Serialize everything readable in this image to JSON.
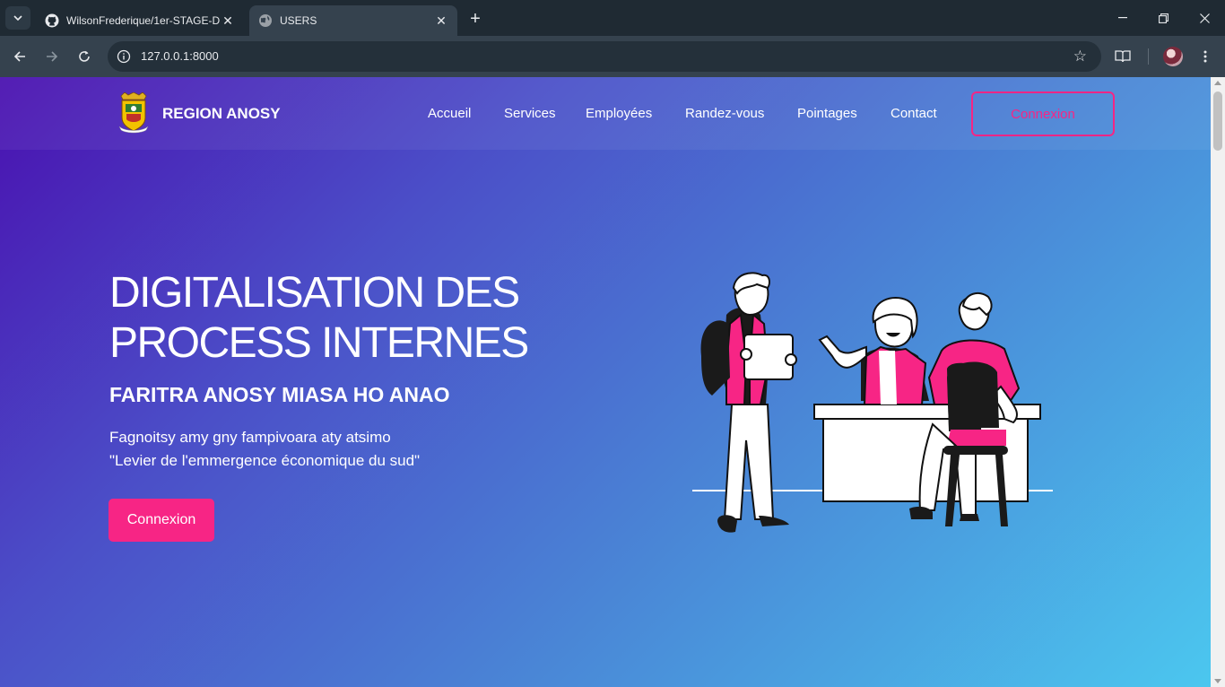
{
  "browser": {
    "tabs": [
      {
        "title": "WilsonFrederique/1er-STAGE-D",
        "icon": "github-icon"
      },
      {
        "title": "USERS",
        "icon": "globe-icon"
      }
    ],
    "url": "127.0.0.1:8000"
  },
  "header": {
    "brand": "REGION ANOSY",
    "nav": [
      "Accueil",
      "Services",
      "Employées",
      "Randez-vous",
      "Pointages",
      "Contact"
    ],
    "login_button": "Connexion"
  },
  "hero": {
    "title_line1": "DIGITALISATION DES",
    "title_line2": "PROCESS INTERNES",
    "subtitle": "FARITRA ANOSY MIASA HO ANAO",
    "para_line1": "Fagnoitsy amy gny fampivoara aty atsimo",
    "para_line2": "\"Levier de l'emmergence économique du sud\"",
    "cta": "Connexion"
  },
  "colors": {
    "accent": "#f72585",
    "gradient_start": "#4a10b0",
    "gradient_end": "#4bc7ef"
  }
}
